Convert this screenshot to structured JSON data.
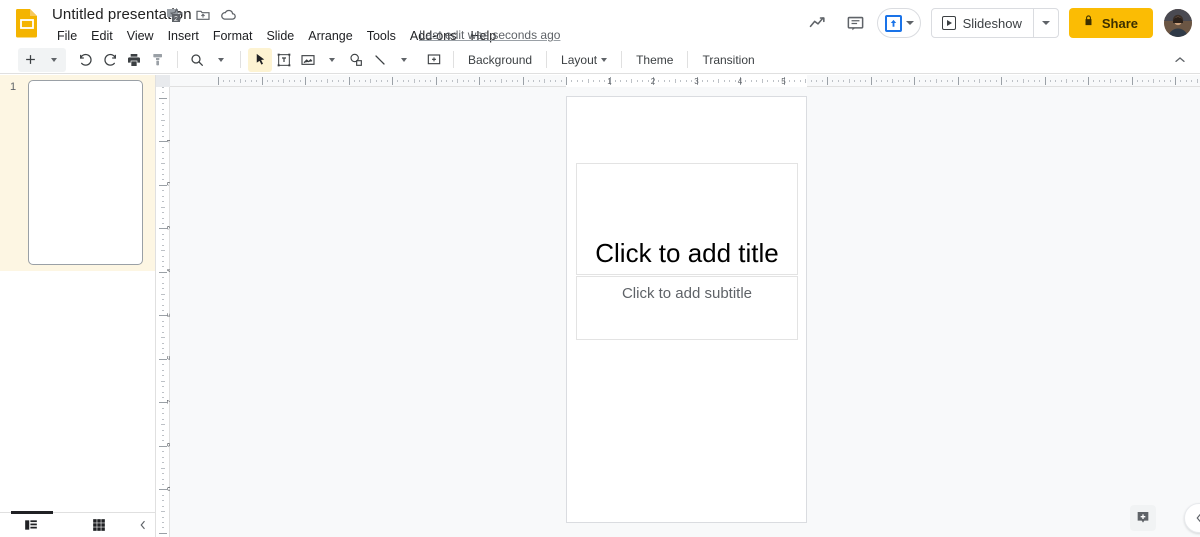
{
  "app": {
    "logo_icon": "google-slides-logo-icon",
    "doc_title": "Untitled presentation",
    "title_icons": [
      {
        "name": "star-icon",
        "label": "Star"
      },
      {
        "name": "move-to-folder-icon",
        "label": "Move to folder"
      },
      {
        "name": "cloud-saved-icon",
        "label": "See document status"
      }
    ],
    "menus": [
      "File",
      "Edit",
      "View",
      "Insert",
      "Format",
      "Slide",
      "Arrange",
      "Tools",
      "Add-ons",
      "Help"
    ],
    "last_edit": "Last edit was seconds ago"
  },
  "header_right": {
    "activity_icon": "trending-up-icon",
    "comment_icon": "comment-icon",
    "present_icon": "present-upload-icon",
    "present_caret": "chevron-down-icon",
    "slideshow_label": "Slideshow",
    "slideshow_icon": "play-box-icon",
    "slideshow_caret": "chevron-down-icon",
    "share_label": "Share",
    "share_lock_icon": "lock-icon",
    "avatar": "user-avatar"
  },
  "toolbar": {
    "items": [
      {
        "name": "new-slide-button",
        "icon": "plus-icon"
      },
      {
        "name": "new-slide-dropdown",
        "icon": "chevron-down-icon"
      },
      {
        "name": "undo-button",
        "icon": "undo-icon"
      },
      {
        "name": "redo-button",
        "icon": "redo-icon"
      },
      {
        "name": "print-button",
        "icon": "printer-icon"
      },
      {
        "name": "paint-format-button",
        "icon": "paint-format-icon"
      },
      {
        "name": "zoom-button",
        "icon": "magnifier-icon"
      },
      {
        "name": "zoom-dropdown",
        "icon": "chevron-down-icon"
      },
      {
        "name": "select-tool-button",
        "icon": "cursor-arrow-icon"
      },
      {
        "name": "text-box-button",
        "icon": "text-box-icon"
      },
      {
        "name": "insert-image-button",
        "icon": "image-icon"
      },
      {
        "name": "insert-image-dropdown",
        "icon": "chevron-down-icon"
      },
      {
        "name": "insert-shape-button",
        "icon": "shape-icon"
      },
      {
        "name": "insert-line-button",
        "icon": "line-icon"
      },
      {
        "name": "insert-line-dropdown",
        "icon": "chevron-down-icon"
      },
      {
        "name": "insert-comment-button",
        "icon": "add-comment-icon"
      }
    ],
    "labels": [
      "Background",
      "Layout",
      "Theme",
      "Transition"
    ],
    "layout_has_caret": true,
    "collapse_icon": "chevron-up-icon"
  },
  "filmstrip": {
    "slides": [
      {
        "number": "1",
        "selected": true
      }
    ],
    "bottom": {
      "filmstrip_view_icon": "filmstrip-view-icon",
      "grid_view_icon": "grid-view-icon",
      "collapse_icon": "chevron-left-icon"
    }
  },
  "rulers": {
    "horizontal_numbers": [
      "1",
      "2",
      "3",
      "4",
      "5"
    ],
    "vertical_numbers": [
      "1",
      "2",
      "3",
      "4",
      "5",
      "6",
      "7",
      "8",
      "9"
    ]
  },
  "slide": {
    "title_placeholder": "Click to add title",
    "subtitle_placeholder": "Click to add subtitle"
  },
  "canvas_controls": {
    "explore_icon": "explore-icon",
    "side_panel_toggle_icon": "chevron-left-icon",
    "notes_handle": "notes-drag-handle"
  },
  "colors": {
    "brand_yellow": "#fbbc04",
    "accent_blue": "#1a73e8",
    "selected_slide_bg": "#fdf6e3",
    "canvas_bg": "#f8f9fa",
    "active_tool_bg": "#fdf3d2"
  }
}
